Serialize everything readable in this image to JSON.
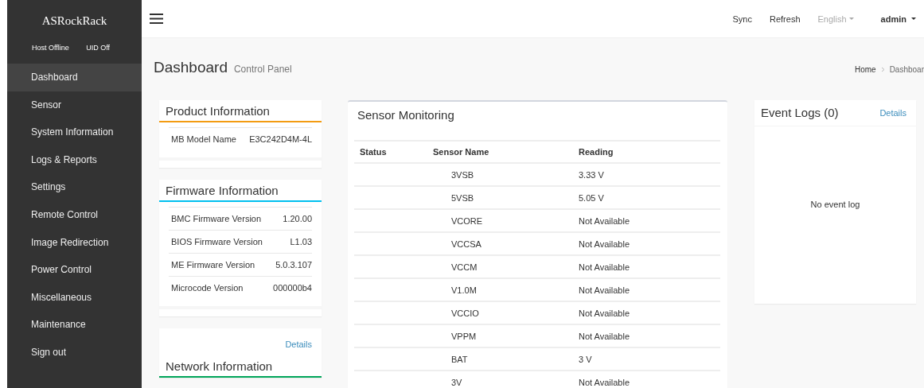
{
  "sidebar": {
    "logo": "ASRockRack",
    "status": [
      "Host Offline",
      "UID Off"
    ],
    "items": [
      {
        "label": "Dashboard",
        "selected": true
      },
      {
        "label": "Sensor",
        "selected": false
      },
      {
        "label": "System Information",
        "selected": false
      },
      {
        "label": "Logs & Reports",
        "selected": false
      },
      {
        "label": "Settings",
        "selected": false
      },
      {
        "label": "Remote Control",
        "selected": false
      },
      {
        "label": "Image Redirection",
        "selected": false
      },
      {
        "label": "Power Control",
        "selected": false
      },
      {
        "label": "Miscellaneous",
        "selected": false
      },
      {
        "label": "Maintenance",
        "selected": false
      },
      {
        "label": "Sign out",
        "selected": false
      }
    ]
  },
  "topbar": {
    "links": [
      "Sync",
      "Refresh"
    ],
    "language": "English",
    "user": "admin"
  },
  "page": {
    "title": "Dashboard",
    "subtitle": "Control Panel",
    "breadcrumb": [
      "Home",
      "Dashboar"
    ]
  },
  "info_cards": [
    {
      "title": "Product Information",
      "color": "#f39c12",
      "rows": [
        [
          "MB Model Name",
          "E3C242D4M-4L"
        ]
      ]
    },
    {
      "title": "Firmware Information",
      "color": "#00c0ef",
      "rows": [
        [
          "BMC Firmware Version",
          "1.20.00"
        ],
        [
          "BIOS Firmware Version",
          "L1.03"
        ],
        [
          "ME Firmware Version",
          "5.0.3.107"
        ],
        [
          "Microcode Version",
          "000000b4"
        ]
      ]
    },
    {
      "title": "Network Information",
      "color": "#00a65a",
      "details": "Details"
    }
  ],
  "sensor_monitoring": {
    "title": "Sensor Monitoring",
    "columns": [
      "Status",
      "Sensor Name",
      "Reading"
    ],
    "rows": [
      [
        "",
        "3VSB",
        "3.33 V"
      ],
      [
        "",
        "5VSB",
        "5.05 V"
      ],
      [
        "",
        "VCORE",
        "Not Available"
      ],
      [
        "",
        "VCCSA",
        "Not Available"
      ],
      [
        "",
        "VCCM",
        "Not Available"
      ],
      [
        "",
        "V1.0M",
        "Not Available"
      ],
      [
        "",
        "VCCIO",
        "Not Available"
      ],
      [
        "",
        "VPPM",
        "Not Available"
      ],
      [
        "",
        "BAT",
        "3 V"
      ],
      [
        "",
        "3V",
        "Not Available"
      ]
    ]
  },
  "event_logs": {
    "title": "Event Logs (0)",
    "details": "Details",
    "empty": "No event log"
  }
}
